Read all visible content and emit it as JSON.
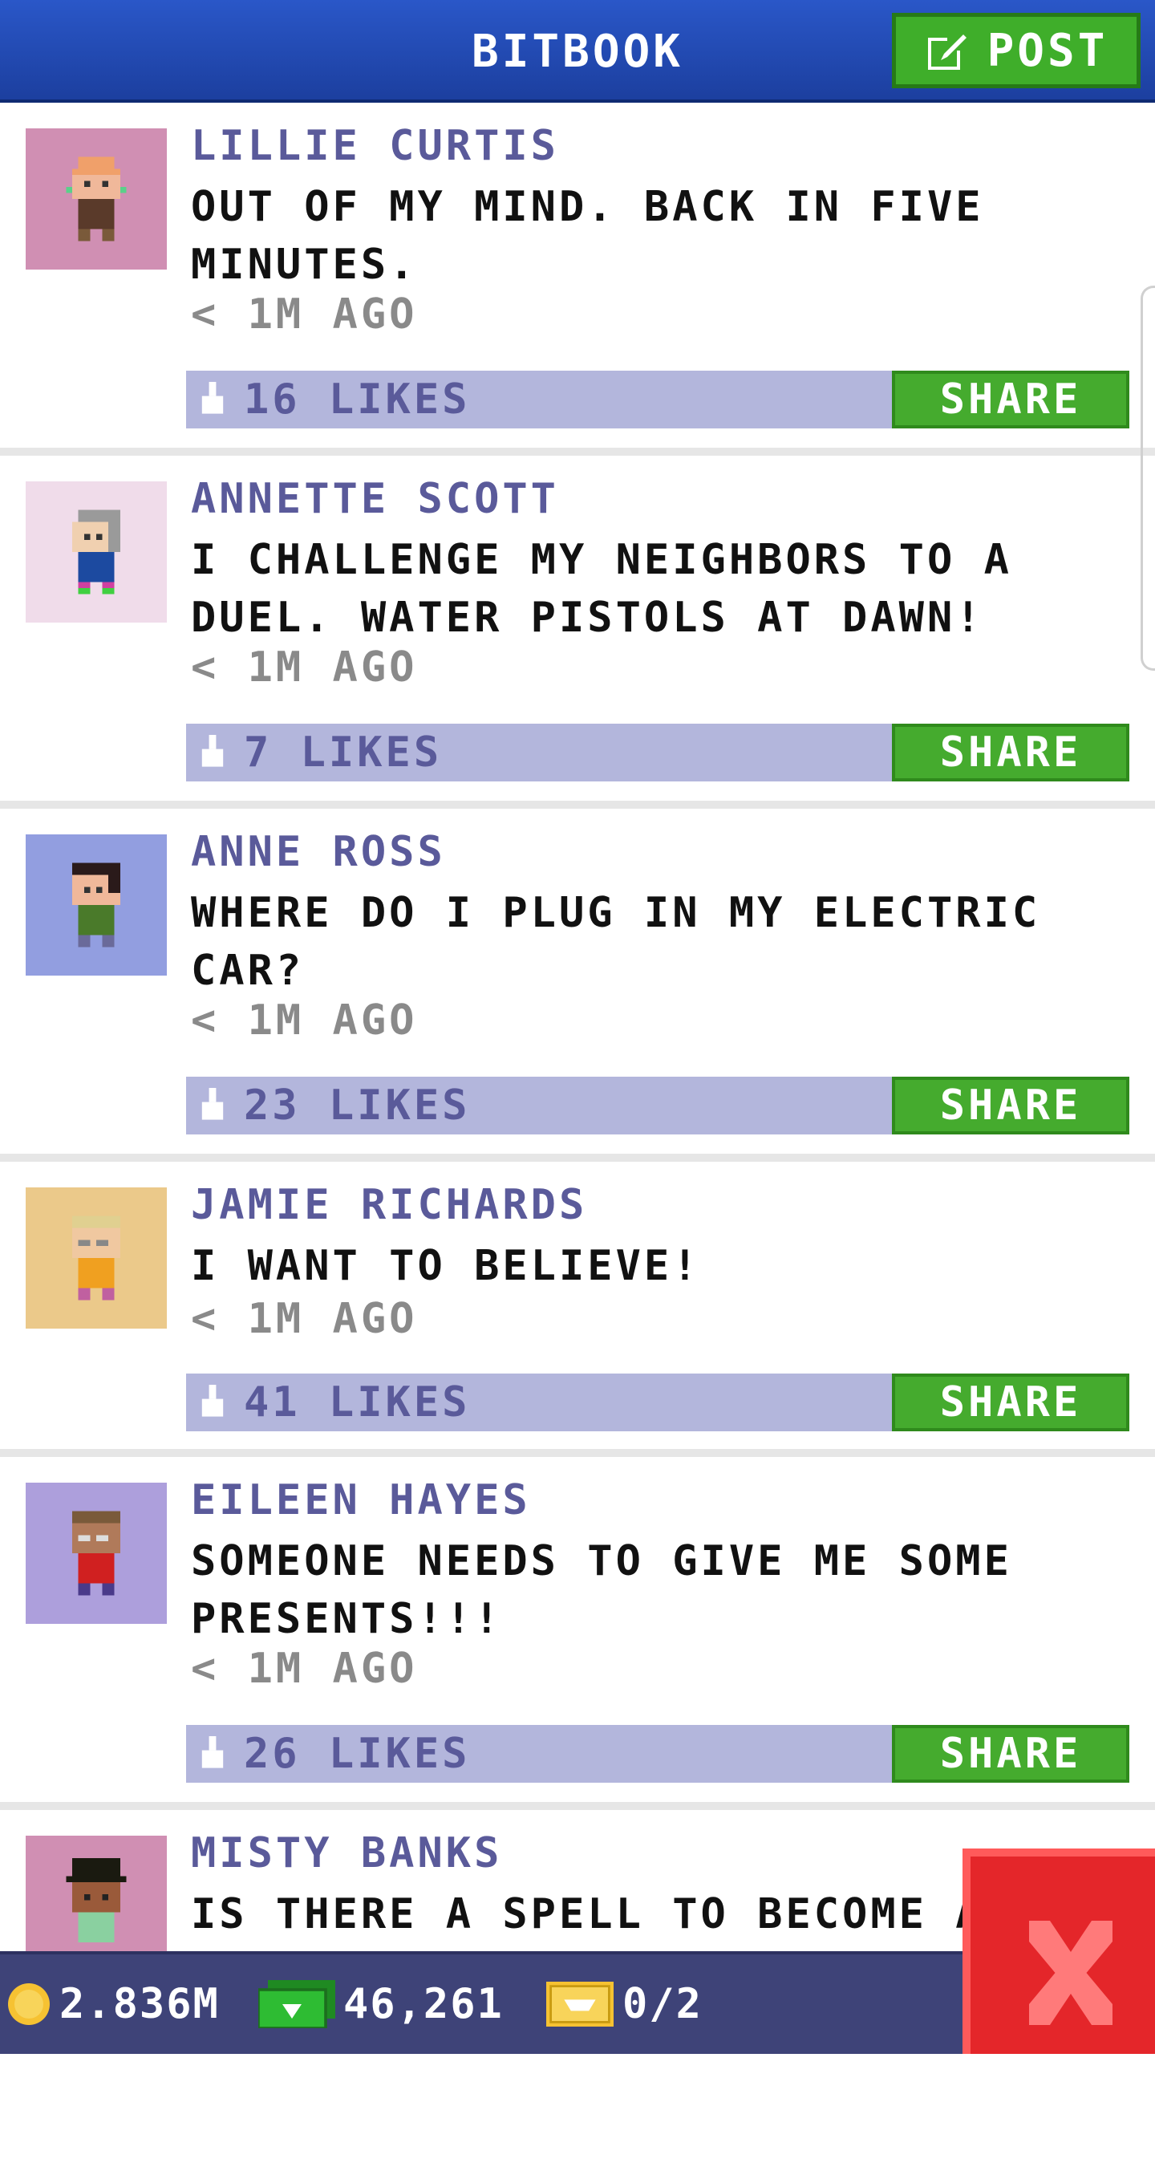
{
  "header": {
    "title": "BITBOOK",
    "post_label": "POST"
  },
  "posts": [
    {
      "author": "LILLIE CURTIS",
      "message": "OUT OF MY MIND. BACK IN FIVE MINUTES.",
      "time": "< 1M AGO",
      "likes": "16 LIKES",
      "share": "SHARE",
      "avatar_bg": "#d08fb3"
    },
    {
      "author": "ANNETTE SCOTT",
      "message": "I CHALLENGE MY NEIGHBORS TO A DUEL. WATER PISTOLS AT DAWN!",
      "time": "< 1M AGO",
      "likes": "7 LIKES",
      "share": "SHARE",
      "avatar_bg": "#f0dcea"
    },
    {
      "author": "ANNE ROSS",
      "message": "WHERE DO I PLUG IN MY ELECTRIC CAR?",
      "time": "< 1M AGO",
      "likes": "23 LIKES",
      "share": "SHARE",
      "avatar_bg": "#929ee0"
    },
    {
      "author": "JAMIE RICHARDS",
      "message": "I WANT TO BELIEVE!",
      "time": "< 1M AGO",
      "likes": "41 LIKES",
      "share": "SHARE",
      "avatar_bg": "#ebc98a"
    },
    {
      "author": "EILEEN HAYES",
      "message": "SOMEONE NEEDS TO GIVE ME SOME PRESENTS!!!",
      "time": "< 1M AGO",
      "likes": "26 LIKES",
      "share": "SHARE",
      "avatar_bg": "#ad9fdc"
    },
    {
      "author": "MISTY BANKS",
      "message": "IS THERE A SPELL TO BECOME A",
      "time": "",
      "likes": "",
      "share": "",
      "avatar_bg": "#d08fb3"
    }
  ],
  "status_bar": {
    "coins": "2.836M",
    "bux": "46,261",
    "tickets": "0/2"
  },
  "colors": {
    "accent": "#1c3f9f",
    "share": "#45ab2e",
    "close": "#e4262a"
  }
}
